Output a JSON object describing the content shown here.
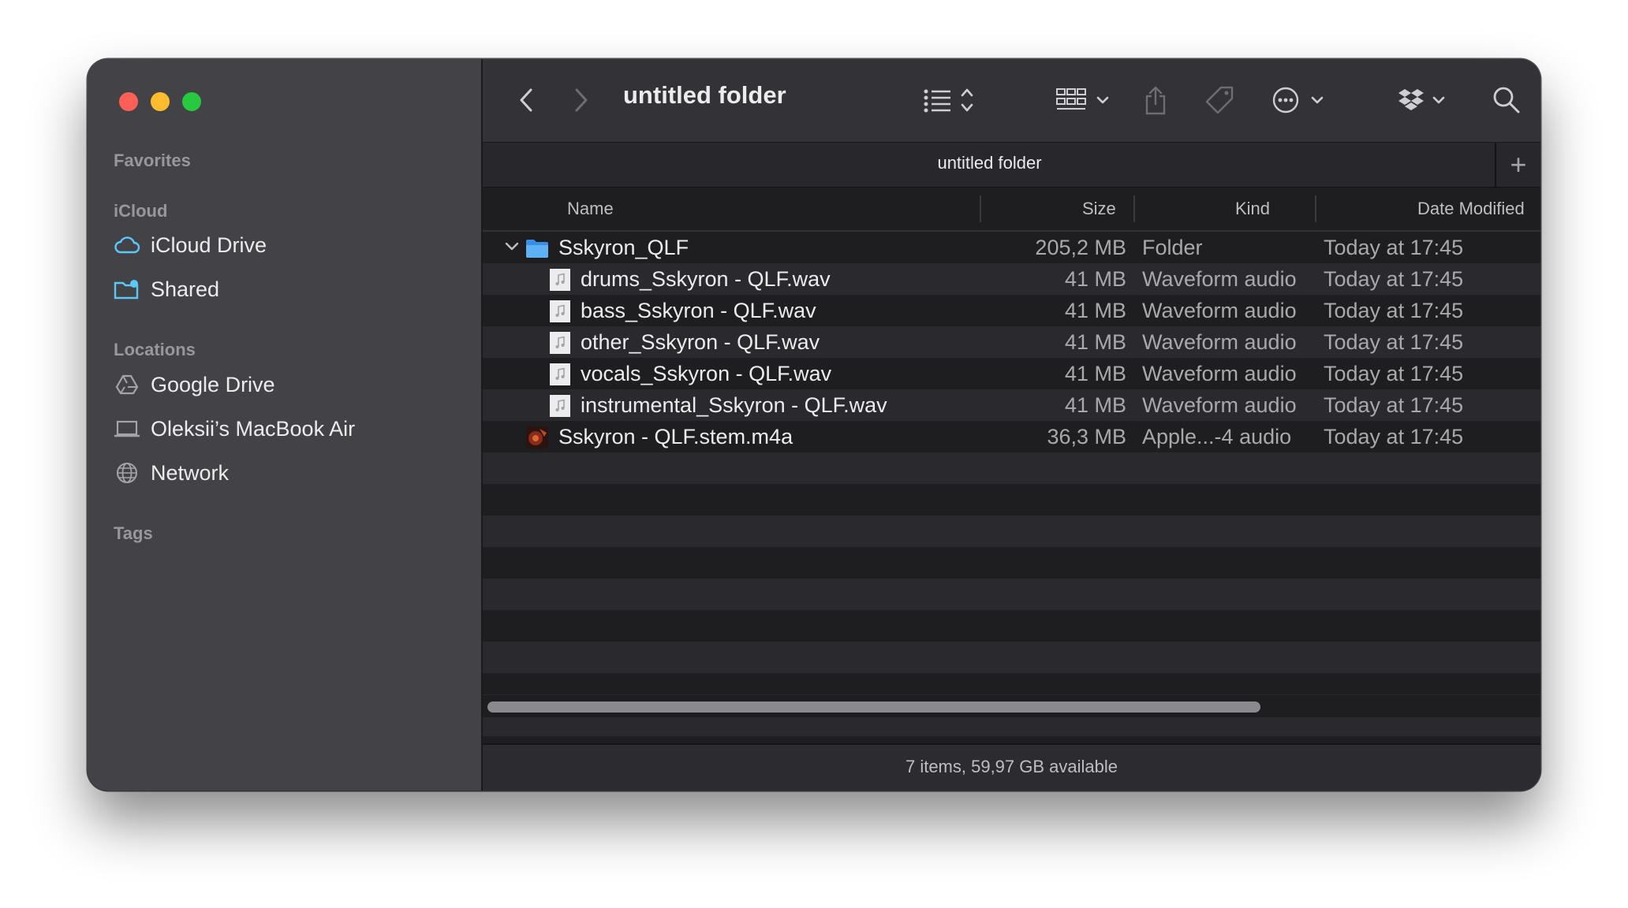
{
  "window": {
    "title": "untitled folder",
    "tab_title": "untitled folder"
  },
  "sidebar": {
    "sections": [
      {
        "label": "Favorites",
        "items": []
      },
      {
        "label": "iCloud",
        "items": [
          {
            "label": "iCloud Drive",
            "icon": "cloud-icon"
          },
          {
            "label": "Shared",
            "icon": "shared-folder-icon"
          }
        ]
      },
      {
        "label": "Locations",
        "items": [
          {
            "label": "Google Drive",
            "icon": "google-drive-icon"
          },
          {
            "label": "Oleksii’s MacBook Air",
            "icon": "laptop-icon"
          },
          {
            "label": "Network",
            "icon": "globe-icon"
          }
        ]
      },
      {
        "label": "Tags",
        "items": []
      }
    ]
  },
  "columns": {
    "name": "Name",
    "size": "Size",
    "kind": "Kind",
    "date": "Date Modified"
  },
  "files": [
    {
      "name": "Sskyron_QLF",
      "size": "205,2 MB",
      "kind": "Folder",
      "date": "Today at 17:45",
      "type": "folder",
      "expanded": true
    },
    {
      "name": "drums_Sskyron - QLF.wav",
      "size": "41 MB",
      "kind": "Waveform audio",
      "date": "Today at 17:45",
      "type": "audio"
    },
    {
      "name": "bass_Sskyron - QLF.wav",
      "size": "41 MB",
      "kind": "Waveform audio",
      "date": "Today at 17:45",
      "type": "audio"
    },
    {
      "name": "other_Sskyron - QLF.wav",
      "size": "41 MB",
      "kind": "Waveform audio",
      "date": "Today at 17:45",
      "type": "audio"
    },
    {
      "name": "vocals_Sskyron - QLF.wav",
      "size": "41 MB",
      "kind": "Waveform audio",
      "date": "Today at 17:45",
      "type": "audio"
    },
    {
      "name": "instrumental_Sskyron - QLF.wav",
      "size": "41 MB",
      "kind": "Waveform audio",
      "date": "Today at 17:45",
      "type": "audio"
    },
    {
      "name": "Sskyron - QLF.stem.m4a",
      "size": "36,3 MB",
      "kind": "Apple...-4 audio",
      "date": "Today at 17:45",
      "type": "artwork"
    }
  ],
  "status": {
    "text": "7 items, 59,97 GB available"
  },
  "colors": {
    "accent": "#5ac8fa",
    "sidebar_bg": "#434247",
    "toolbar_bg": "#333236"
  }
}
